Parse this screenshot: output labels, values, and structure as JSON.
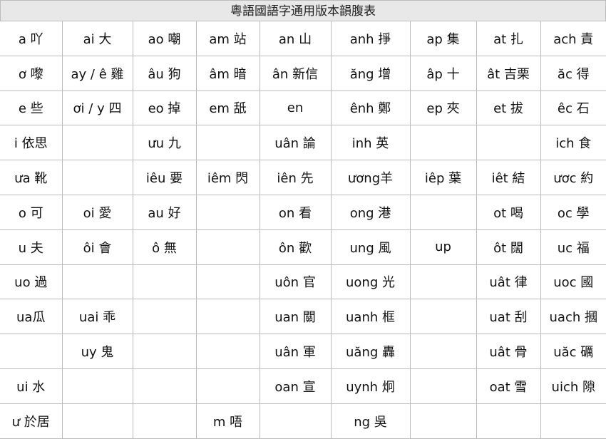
{
  "table": {
    "title": "粵語國語字通用版本韻腹表",
    "rows": [
      [
        "a 吖",
        "ai 大",
        "ao 嘲",
        "am 站",
        "an 山",
        "anh 掙",
        "ap 集",
        "at 扎",
        "ach 責"
      ],
      [
        "ơ 嚟",
        "ay / ê 雞",
        "âu 狗",
        "âm 暗",
        "ân 新信",
        "ăng 增",
        "âp 十",
        "ât 吉栗",
        "ăc 得"
      ],
      [
        "e 些",
        "ơi / y 四",
        "eo 掉",
        "em 舐",
        "en",
        "ênh 鄭",
        "ep 夾",
        "et 拔",
        "êc 石"
      ],
      [
        "i 依思",
        "",
        "ưu 九",
        "",
        "uân 論",
        "inh 英",
        "",
        "",
        "ich 食"
      ],
      [
        "ưa 靴",
        "",
        "iêu 要",
        "iêm 閃",
        "iên 先",
        "ương羊",
        "iêp 葉",
        "iêt 結",
        "ươc 約"
      ],
      [
        "o 可",
        "oi 愛",
        "au 好",
        "",
        "on 看",
        "ong 港",
        "",
        "ot 喝",
        "oc 學"
      ],
      [
        "u 夫",
        "ôi 會",
        "ô 無",
        "",
        "ôn 歡",
        "ung 風",
        "up",
        "ôt 闊",
        "uc 福"
      ],
      [
        "uo 過",
        "",
        "",
        "",
        "uôn 官",
        "uong 光",
        "",
        "uât 律",
        "uoc 國"
      ],
      [
        "ua瓜",
        "uai 乖",
        "",
        "",
        "uan 關",
        "uanh 框",
        "",
        "uat 刮",
        "uach 摑"
      ],
      [
        "",
        "uy 鬼",
        "",
        "",
        "uân 軍",
        "uăng 轟",
        "",
        "uât 骨",
        "uăc 礪"
      ],
      [
        "ui 水",
        "",
        "",
        "",
        "oan 宣",
        "uynh 炯",
        "",
        "oat 雪",
        "uich 隙"
      ],
      [
        "ư 於居",
        "",
        "",
        "m 唔",
        "",
        "ng 吳",
        "",
        "",
        ""
      ]
    ]
  }
}
